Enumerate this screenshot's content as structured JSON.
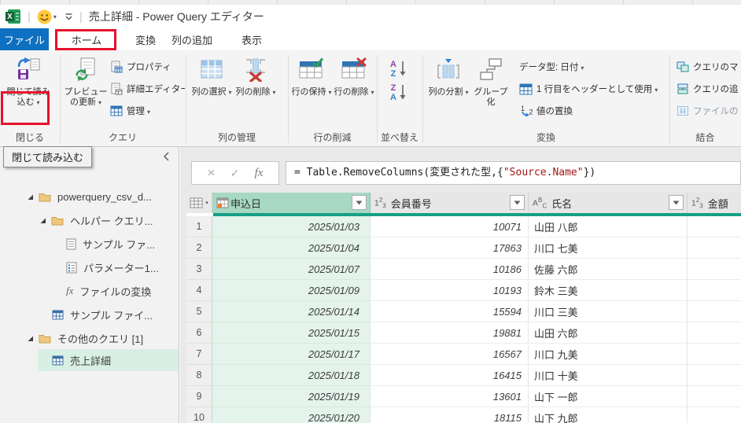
{
  "titlebar": {
    "title": "売上詳細 - Power Query エディター"
  },
  "tabs": [
    {
      "label": "ファイル"
    },
    {
      "label": "ホーム"
    },
    {
      "label": "変換"
    },
    {
      "label": "列の追加"
    },
    {
      "label": "表示"
    }
  ],
  "ribbon": {
    "close_load": "閉じて読み込む",
    "group_close": "閉じる",
    "refresh_preview": "プレビューの更新",
    "properties": "プロパティ",
    "advanced_editor": "詳細エディター",
    "manage": "管理",
    "group_query": "クエリ",
    "choose_columns": "列の選択",
    "remove_columns": "列の削除",
    "group_manage_columns": "列の管理",
    "keep_rows": "行の保持",
    "remove_rows": "行の削除",
    "group_reduce_rows": "行の削減",
    "group_sort": "並べ替え",
    "split_column": "列の分割",
    "group_by": "グループ化",
    "data_type": "データ型: 日付",
    "use_first_row": "1 行目をヘッダーとして使用",
    "replace_values": "値の置換",
    "group_transform": "変換",
    "merge_queries": "クエリのマ",
    "append_queries": "クエリの追",
    "combine_files": "ファイルの",
    "group_combine": "結合"
  },
  "tooltip": {
    "text": "閉じて読み込む"
  },
  "formula": {
    "before": "= Table.RemoveColumns(変更された型,{",
    "string": "\"Source.Name\"",
    "after": "})"
  },
  "sidebar": {
    "items": [
      {
        "label": "powerquery_csv_d...",
        "icon": "folder",
        "expanded": true
      },
      {
        "label": "ヘルパー クエリ...",
        "icon": "folder",
        "expanded": true
      },
      {
        "label": "サンプル ファ...",
        "icon": "document"
      },
      {
        "label": "パラメーター1...",
        "icon": "parameter"
      },
      {
        "label": "ファイルの変換",
        "icon": "function"
      },
      {
        "label": "サンプル ファイ...",
        "icon": "table"
      },
      {
        "label": "その他のクエリ [1]",
        "icon": "folder",
        "expanded": true
      },
      {
        "label": "売上詳細",
        "icon": "table",
        "selected": true
      }
    ]
  },
  "table": {
    "columns": [
      {
        "name": "申込日",
        "type": "date",
        "selected": true
      },
      {
        "name": "会員番号",
        "type": "number"
      },
      {
        "name": "氏名",
        "type": "text"
      },
      {
        "name": "金額",
        "type": "number"
      }
    ],
    "rows": [
      {
        "n": "1",
        "date": "2025/01/03",
        "member": "10071",
        "name": "山田 八郎",
        "amount": ""
      },
      {
        "n": "2",
        "date": "2025/01/04",
        "member": "17863",
        "name": "川口 七美",
        "amount": ""
      },
      {
        "n": "3",
        "date": "2025/01/07",
        "member": "10186",
        "name": "佐藤 六郎",
        "amount": ""
      },
      {
        "n": "4",
        "date": "2025/01/09",
        "member": "10193",
        "name": "鈴木 三美",
        "amount": ""
      },
      {
        "n": "5",
        "date": "2025/01/14",
        "member": "15594",
        "name": "川口 三美",
        "amount": ""
      },
      {
        "n": "6",
        "date": "2025/01/15",
        "member": "19881",
        "name": "山田 六郎",
        "amount": ""
      },
      {
        "n": "7",
        "date": "2025/01/17",
        "member": "16567",
        "name": "川口 九美",
        "amount": ""
      },
      {
        "n": "8",
        "date": "2025/01/18",
        "member": "16415",
        "name": "川口 十美",
        "amount": ""
      },
      {
        "n": "9",
        "date": "2025/01/19",
        "member": "13601",
        "name": "山下 一郎",
        "amount": ""
      },
      {
        "n": "10",
        "date": "2025/01/20",
        "member": "18115",
        "name": "山下 九郎",
        "amount": ""
      }
    ]
  },
  "icons": {
    "cancel": "×",
    "commit": "✓",
    "fx": "fx",
    "excel-logo": "X",
    "smiley-feedback": "smiley",
    "caret": "▾"
  },
  "colors": {
    "accent_teal": "#16a085",
    "selected_header": "#a6d8c3",
    "selected_cells": "#e4f3eb",
    "sidebar_selected": "#d8f0e3",
    "file_tab_blue": "#0e70c0",
    "annotation_red": "#e8112d",
    "string_literal": "#a31515",
    "excel_green": "#1d9b55",
    "smiley_yellow": "#ffc83d"
  }
}
